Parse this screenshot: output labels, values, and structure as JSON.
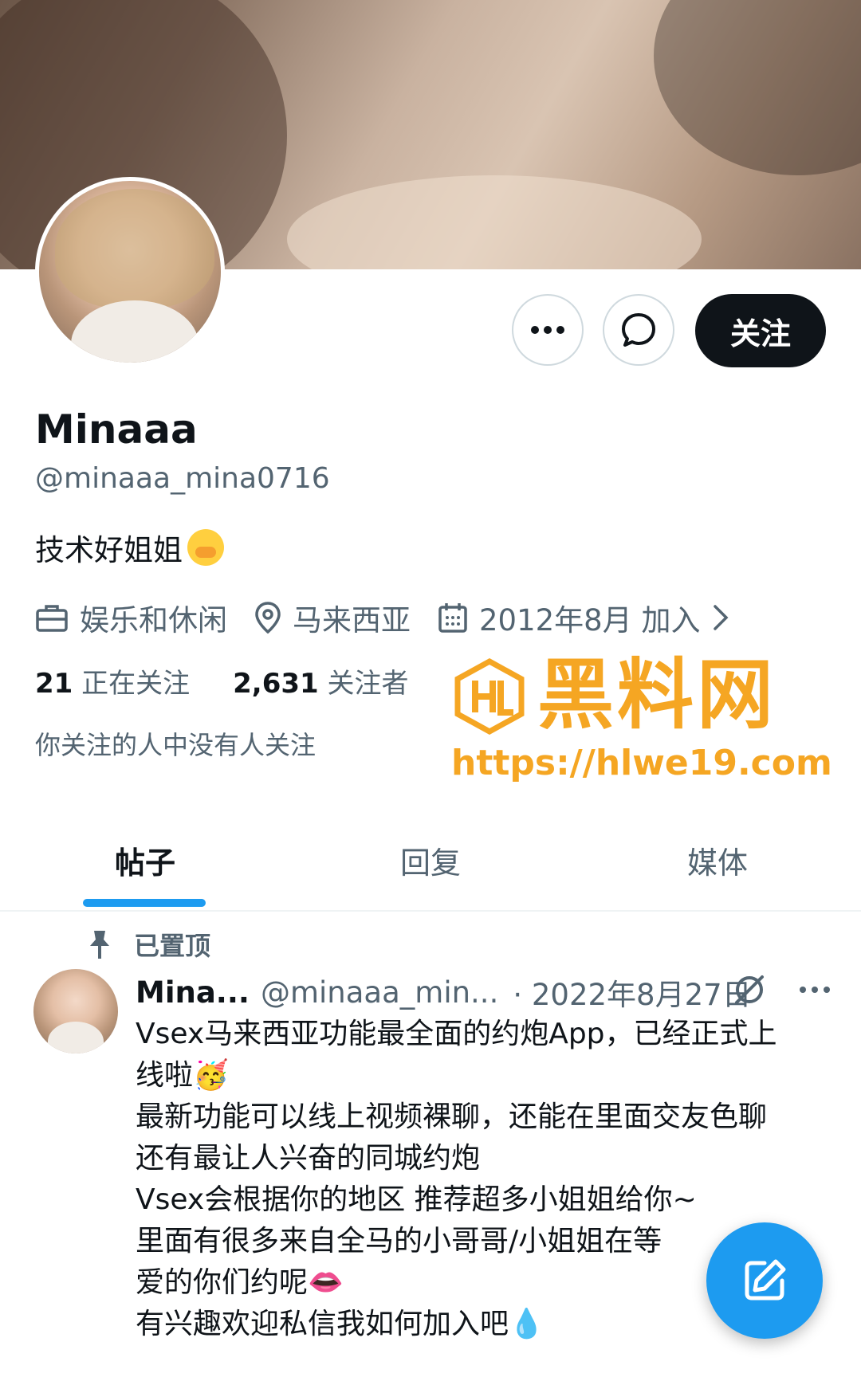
{
  "profile": {
    "display_name": "Minaaa",
    "handle": "@minaaa_mina0716",
    "bio": "技术好姐姐",
    "category": "娱乐和休闲",
    "location": "马来西亚",
    "joined": "2012年8月 加入",
    "following_count": "21",
    "following_label": "正在关注",
    "followers_count": "2,631",
    "followers_label": "关注者",
    "mutual_note": "你关注的人中没有人关注"
  },
  "actions": {
    "more_icon": "more-icon",
    "message_icon": "message-icon",
    "follow_label": "关注"
  },
  "watermark": {
    "title": "黑料网",
    "url": "https://hlwe19.com"
  },
  "tabs": [
    {
      "label": "帖子",
      "active": true
    },
    {
      "label": "回复",
      "active": false
    },
    {
      "label": "媒体",
      "active": false
    }
  ],
  "post": {
    "pinned_label": "已置顶",
    "author_name": "Mina...",
    "author_handle": "@minaaa_min...",
    "date": "· 2022年8月27日",
    "lines": [
      "Vsex马来西亚功能最全面的约炮App，已经正式上",
      "线啦🥳",
      "",
      "最新功能可以线上视频裸聊，还能在里面交友色聊",
      "还有最让人兴奋的同城约炮",
      "Vsex会根据你的地区 推荐超多小姐姐给你~",
      "里面有很多来自全马的小哥哥/小姐姐在等",
      "爱的你们约呢👄",
      "有兴趣欢迎私信我如何加入吧💧"
    ]
  },
  "colors": {
    "accent": "#1d9bf0",
    "text_primary": "#0f1419",
    "text_secondary": "#536471",
    "watermark": "#f5a623"
  }
}
